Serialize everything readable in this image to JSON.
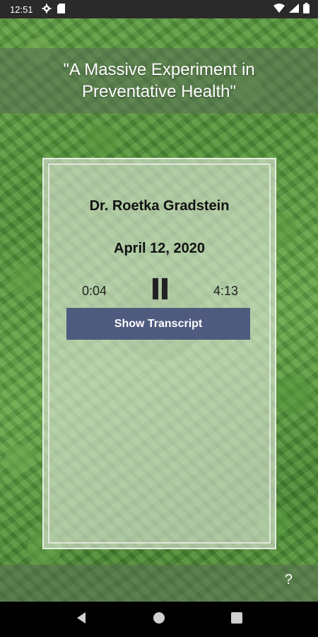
{
  "status_bar": {
    "time": "12:51",
    "icons": [
      "gear-icon",
      "sd-card-icon",
      "wifi-icon",
      "signal-icon",
      "battery-icon"
    ]
  },
  "header": {
    "title": "\"A Massive Experiment in Preventative Health\""
  },
  "player": {
    "speaker": "Dr. Roetka Gradstein",
    "date": "April 12, 2020",
    "elapsed": "0:04",
    "duration": "4:13",
    "state": "playing",
    "transcript_button_label": "Show Transcript"
  },
  "footer": {
    "help_label": "?"
  },
  "nav": {
    "icons": [
      "back-icon",
      "home-icon",
      "recents-icon"
    ]
  },
  "colors": {
    "button_bg": "#4f5b7e",
    "banner_bg": "#5a6e55",
    "card_bg": "#e1e8dc",
    "status_bar_bg": "#2a2a2a",
    "nav_bar_bg": "#000000"
  }
}
